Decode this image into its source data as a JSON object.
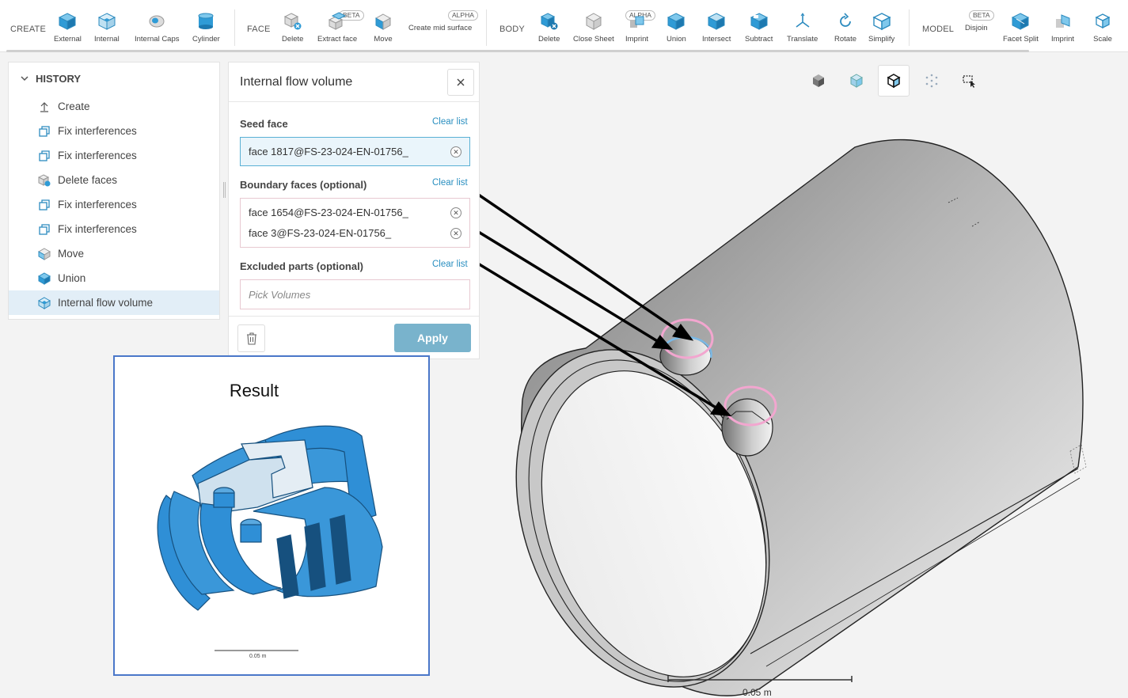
{
  "toolbar": {
    "groups": {
      "create": "CREATE",
      "face": "FACE",
      "body": "BODY",
      "model": "MODEL"
    },
    "create": [
      "External",
      "Internal",
      "Internal Caps",
      "Cylinder"
    ],
    "face": [
      "Delete",
      "Extract face",
      "Move",
      "Create mid surface"
    ],
    "body": [
      "Delete",
      "Close Sheet",
      "Imprint",
      "Union",
      "Intersect",
      "Subtract",
      "Translate",
      "Rotate",
      "Simplify"
    ],
    "model": [
      "Disjoin",
      "Facet Split",
      "Imprint",
      "Scale"
    ],
    "tags": {
      "beta": "BETA",
      "alpha": "ALPHA"
    }
  },
  "history": {
    "title": "HISTORY",
    "items": [
      {
        "label": "Create",
        "icon": "upload-icon"
      },
      {
        "label": "Fix interferences",
        "icon": "copy-icon"
      },
      {
        "label": "Fix interferences",
        "icon": "copy-icon"
      },
      {
        "label": "Delete faces",
        "icon": "delete-face-icon"
      },
      {
        "label": "Fix interferences",
        "icon": "copy-icon"
      },
      {
        "label": "Fix interferences",
        "icon": "copy-icon"
      },
      {
        "label": "Move",
        "icon": "move-cube-icon"
      },
      {
        "label": "Union",
        "icon": "union-cube-icon"
      },
      {
        "label": "Internal flow volume",
        "icon": "internal-volume-icon"
      }
    ]
  },
  "dialog": {
    "title": "Internal flow volume",
    "seed_label": "Seed face",
    "seed_value": "face 1817@FS-23-024-EN-01756_",
    "boundary_label": "Boundary faces (optional)",
    "boundary_values": [
      "face 1654@FS-23-024-EN-01756_",
      "face 3@FS-23-024-EN-01756_"
    ],
    "excluded_label": "Excluded parts (optional)",
    "excluded_placeholder": "Pick Volumes",
    "clear_list": "Clear list",
    "apply": "Apply"
  },
  "viewport": {
    "scale_label": "0.05 m"
  },
  "result": {
    "title": "Result",
    "scale_label": "0.05 m"
  },
  "colors": {
    "accent": "#2a8fc0",
    "apply_button": "#79b3cc",
    "result_border": "#4a77c9",
    "highlight_ring": "#f2a6cf",
    "result_body": "#2f8fd6"
  }
}
